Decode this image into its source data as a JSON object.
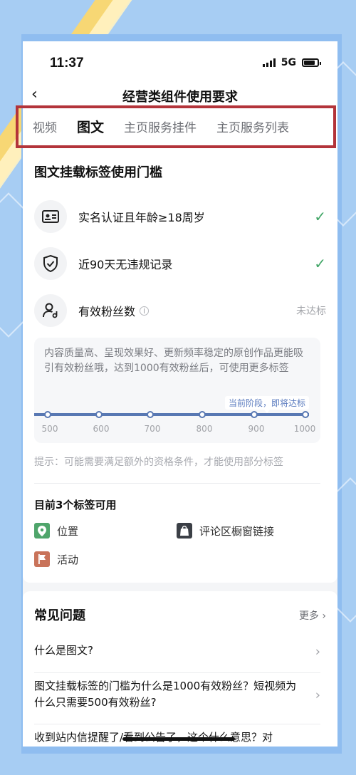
{
  "status_bar": {
    "time": "11:37",
    "network": "5G"
  },
  "nav": {
    "back": "‹",
    "title": "经营类组件使用要求"
  },
  "tabs": [
    {
      "label": "视频",
      "active": false
    },
    {
      "label": "图文",
      "active": true
    },
    {
      "label": "主页服务挂件",
      "active": false
    },
    {
      "label": "主页服务列表",
      "active": false
    }
  ],
  "card": {
    "title": "图文挂载标签使用门槛",
    "requirements": [
      {
        "label": "实名认证且年龄≥18周岁",
        "status": "✓",
        "icon": "id-card-icon"
      },
      {
        "label": "近90天无违规记录",
        "status": "✓",
        "icon": "shield-check-icon"
      },
      {
        "label": "有效粉丝数",
        "info": "i",
        "status": "未达标",
        "icon": "user-follow-icon"
      }
    ],
    "progress": {
      "description": "内容质量高、呈现效果好、更新频率稳定的原创作品更能吸引有效粉丝哦，达到1000有效粉丝后，可使用更多标签",
      "stage_label": "当前阶段，即将达标",
      "ticks": [
        "500",
        "600",
        "700",
        "800",
        "900",
        "1000"
      ]
    },
    "hint": "提示：可能需要满足额外的资格条件，才能使用部分标签",
    "available_title": "目前3个标签可用",
    "tags": [
      {
        "label": "位置",
        "icon": "location-icon",
        "color": "#4fa56b"
      },
      {
        "label": "评论区橱窗链接",
        "icon": "shopping-bag-icon",
        "color": "#3b3f46"
      },
      {
        "label": "活动",
        "icon": "flag-icon",
        "color": "#c9735a"
      }
    ]
  },
  "faq": {
    "title": "常见问题",
    "more": "更多",
    "items": [
      "什么是图文?",
      "图文挂载标签的门槛为什么是1000有效粉丝？短视频为什么只需要500有效粉丝?",
      "收到站内信提醒了/看到公告了，这个什么意思？对"
    ]
  },
  "colors": {
    "accent": "#5878b3",
    "success": "#3fa565",
    "highlight_box": "#b3343a",
    "background": "#a7cdf3"
  }
}
